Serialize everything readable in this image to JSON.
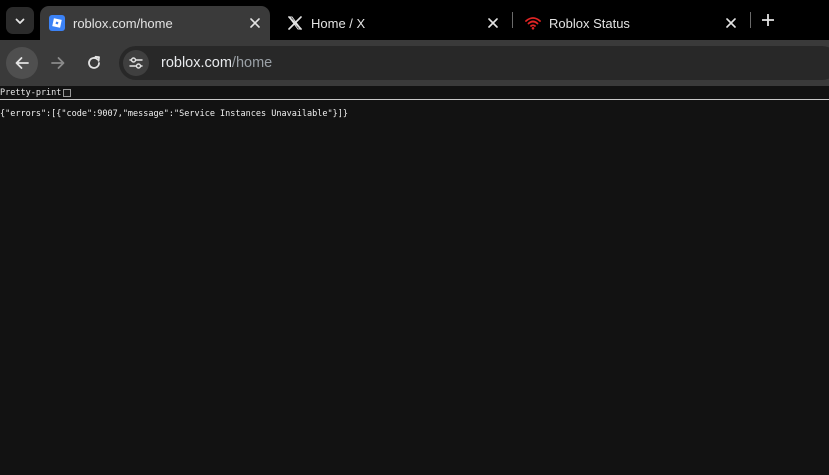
{
  "tabs": [
    {
      "title": "roblox.com/home",
      "favicon": "roblox-logo-icon",
      "active": true
    },
    {
      "title": "Home / X",
      "favicon": "x-logo-icon",
      "active": false
    },
    {
      "title": "Roblox Status",
      "favicon": "wifi-signal-icon",
      "active": false
    }
  ],
  "address_bar": {
    "host": "roblox.com",
    "path": "/home"
  },
  "viewer": {
    "pretty_print_label": "Pretty-print",
    "pretty_print_checked": false,
    "json_text": "{\"errors\":[{\"code\":9007,\"message\":\"Service Instances Unavailable\"}]}"
  },
  "colors": {
    "roblox_blue": "#3b82f6",
    "status_red": "#e02424"
  }
}
